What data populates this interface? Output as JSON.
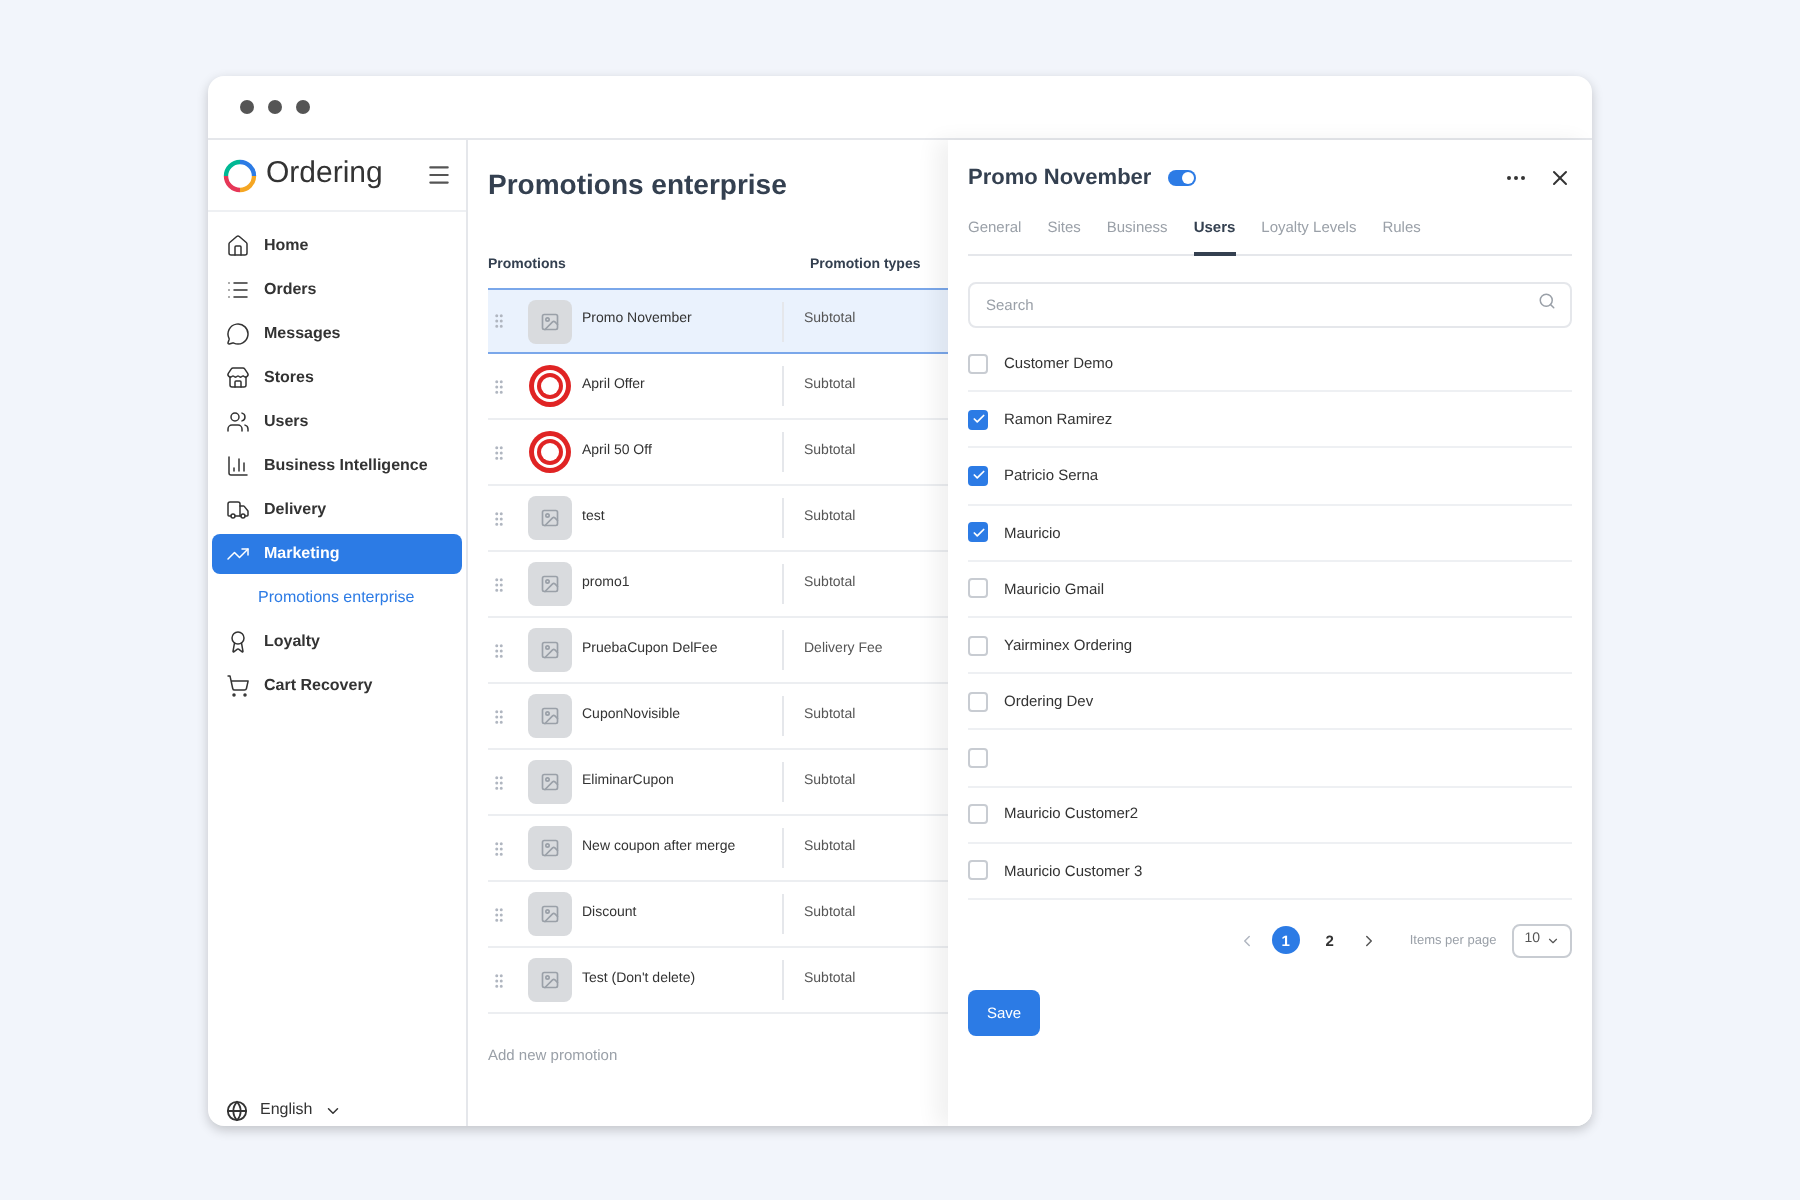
{
  "sidebar": {
    "brand": "Ordering",
    "items": [
      {
        "label": "Home",
        "selected": false
      },
      {
        "label": "Orders",
        "selected": false
      },
      {
        "label": "Messages",
        "selected": false
      },
      {
        "label": "Stores",
        "selected": false
      },
      {
        "label": "Users",
        "selected": false
      },
      {
        "label": "Business Intelligence",
        "selected": false
      },
      {
        "label": "Delivery",
        "selected": false
      },
      {
        "label": "Marketing",
        "selected": true,
        "children": [
          {
            "label": "Promotions enterprise",
            "selected": true
          }
        ]
      },
      {
        "label": "Loyalty",
        "selected": false
      },
      {
        "label": "Cart Recovery",
        "selected": false
      }
    ],
    "language": "English"
  },
  "main": {
    "title": "Promotions enterprise",
    "columns": [
      "Promotions",
      "Promotion types"
    ],
    "rows": [
      {
        "name": "Promo November",
        "type": "Subtotal",
        "kind": "placeholder",
        "selected": true
      },
      {
        "name": "April Offer",
        "type": "Subtotal",
        "kind": "badge",
        "selected": false
      },
      {
        "name": "April 50 Off",
        "type": "Subtotal",
        "kind": "badge",
        "selected": false
      },
      {
        "name": "test",
        "type": "Subtotal",
        "kind": "placeholder",
        "selected": false
      },
      {
        "name": "promo1",
        "type": "Subtotal",
        "kind": "placeholder",
        "selected": false
      },
      {
        "name": "PruebaCupon DelFee",
        "type": "Delivery Fee",
        "kind": "placeholder",
        "selected": false
      },
      {
        "name": "CuponNovisible",
        "type": "Subtotal",
        "kind": "placeholder",
        "selected": false
      },
      {
        "name": "EliminarCupon",
        "type": "Subtotal",
        "kind": "placeholder",
        "selected": false
      },
      {
        "name": "New coupon after merge",
        "type": "Subtotal",
        "kind": "placeholder",
        "selected": false
      },
      {
        "name": "Discount",
        "type": "Subtotal",
        "kind": "placeholder",
        "selected": false
      },
      {
        "name": "Test (Don't delete)",
        "type": "Subtotal",
        "kind": "placeholder",
        "selected": false
      }
    ],
    "add_link": "Add new promotion"
  },
  "panel": {
    "title": "Promo November",
    "enabled": true,
    "tabs": [
      {
        "label": "General",
        "selected": false
      },
      {
        "label": "Sites",
        "selected": false
      },
      {
        "label": "Business",
        "selected": false
      },
      {
        "label": "Users",
        "selected": true
      },
      {
        "label": "Loyalty Levels",
        "selected": false
      },
      {
        "label": "Rules",
        "selected": false
      }
    ],
    "search": {
      "placeholder": "Search"
    },
    "users": [
      {
        "name": "Customer Demo",
        "checked": false
      },
      {
        "name": "Ramon Ramirez",
        "checked": true
      },
      {
        "name": "Patricio Serna",
        "checked": true
      },
      {
        "name": "Mauricio",
        "checked": true
      },
      {
        "name": "Mauricio Gmail",
        "checked": false
      },
      {
        "name": "Yairminex Ordering",
        "checked": false
      },
      {
        "name": "Ordering Dev",
        "checked": false
      },
      {
        "checked": false
      },
      {
        "name": "Mauricio Customer2",
        "checked": false
      },
      {
        "name": "Mauricio Customer 3",
        "checked": false
      }
    ],
    "pages": [
      {
        "label": "1",
        "selected": true
      },
      {
        "label": "2",
        "selected": false
      }
    ],
    "items_per_page_label": "Items per page",
    "items_per_page": "10",
    "save": "Save"
  }
}
